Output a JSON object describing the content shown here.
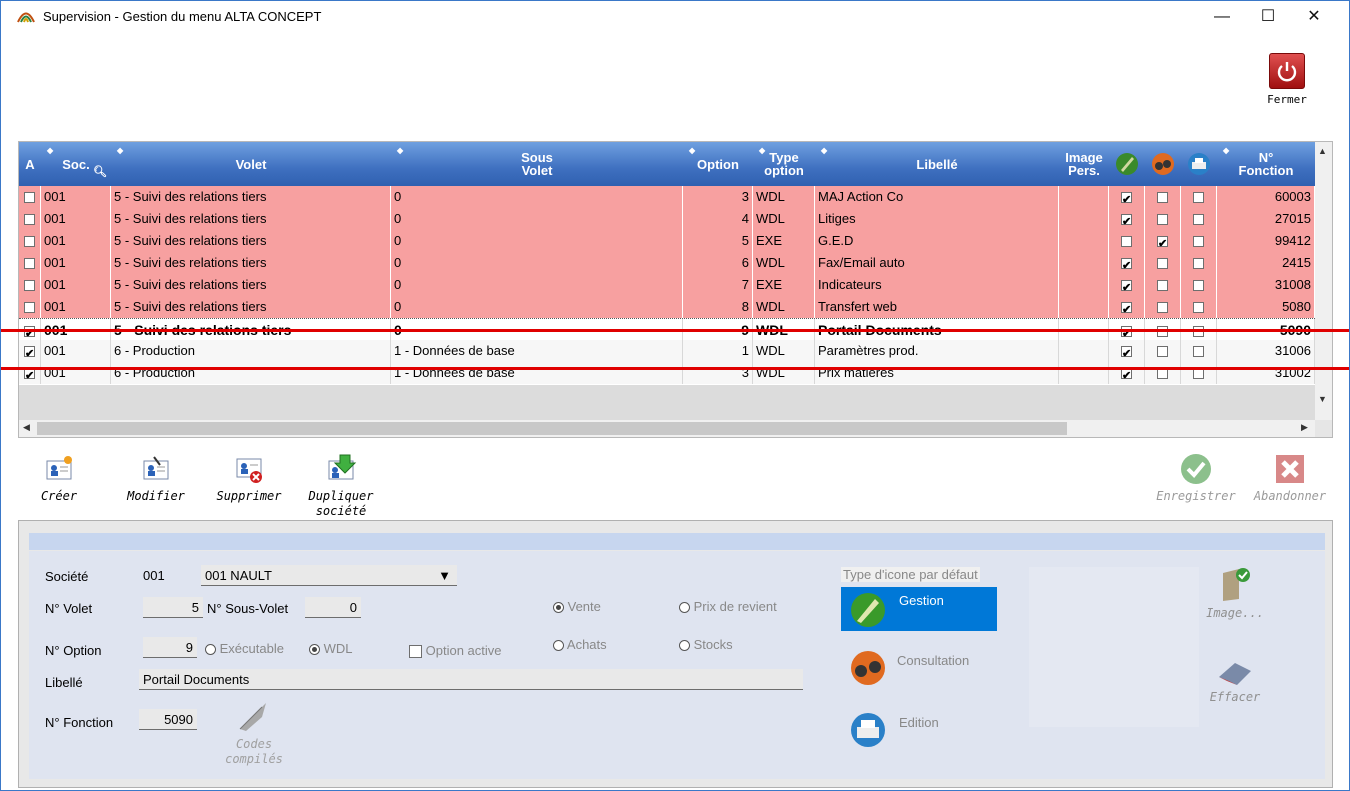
{
  "window": {
    "title": "Supervision - Gestion du menu ALTA CONCEPT",
    "minimize": "—",
    "maximize": "☐",
    "close": "✕",
    "fermer_label": "Fermer"
  },
  "grid": {
    "headers": {
      "a": "A",
      "soc": "Soc.",
      "volet": "Volet",
      "sous_volet_1": "Sous",
      "sous_volet_2": "Volet",
      "option": "Option",
      "type_1": "Type",
      "type_2": "option",
      "libelle": "Libellé",
      "image_1": "Image",
      "image_2": "Pers.",
      "fonction_1": "N°",
      "fonction_2": "Fonction"
    },
    "rows": [
      {
        "soc": "001",
        "volet": "5 - Suivi des relations tiers",
        "sous_volet": "0",
        "option": "3",
        "type": "WDL",
        "libelle": "MAJ Action Co",
        "a": false,
        "g": true,
        "c": false,
        "e": false,
        "fonction": "60003"
      },
      {
        "soc": "001",
        "volet": "5 - Suivi des relations tiers",
        "sous_volet": "0",
        "option": "4",
        "type": "WDL",
        "libelle": "Litiges",
        "a": false,
        "g": true,
        "c": false,
        "e": false,
        "fonction": "27015"
      },
      {
        "soc": "001",
        "volet": "5 - Suivi des relations tiers",
        "sous_volet": "0",
        "option": "5",
        "type": "EXE",
        "libelle": "G.E.D",
        "a": false,
        "g": false,
        "c": true,
        "e": false,
        "fonction": "99412"
      },
      {
        "soc": "001",
        "volet": "5 - Suivi des relations tiers",
        "sous_volet": "0",
        "option": "6",
        "type": "WDL",
        "libelle": "Fax/Email auto",
        "a": false,
        "g": true,
        "c": false,
        "e": false,
        "fonction": "2415"
      },
      {
        "soc": "001",
        "volet": "5 - Suivi des relations tiers",
        "sous_volet": "0",
        "option": "7",
        "type": "EXE",
        "libelle": "Indicateurs",
        "a": false,
        "g": true,
        "c": false,
        "e": false,
        "fonction": "31008"
      },
      {
        "soc": "001",
        "volet": "5 - Suivi des relations tiers",
        "sous_volet": "0",
        "option": "8",
        "type": "WDL",
        "libelle": "Transfert web",
        "a": false,
        "g": true,
        "c": false,
        "e": false,
        "fonction": "5080"
      },
      {
        "soc": "001",
        "volet": "5 - Suivi des relations tiers",
        "sous_volet": "0",
        "option": "9",
        "type": "WDL",
        "libelle": "Portail Documents",
        "a": true,
        "g": true,
        "c": false,
        "e": false,
        "fonction": "5090"
      },
      {
        "soc": "001",
        "volet": "6 - Production",
        "sous_volet": "1 - Données de base",
        "option": "1",
        "type": "WDL",
        "libelle": "Paramètres prod.",
        "a": true,
        "g": true,
        "c": false,
        "e": false,
        "fonction": "31006"
      },
      {
        "soc": "001",
        "volet": "6 - Production",
        "sous_volet": "1 - Données de base",
        "option": "3",
        "type": "WDL",
        "libelle": "Prix matières",
        "a": true,
        "g": true,
        "c": false,
        "e": false,
        "fonction": "31002"
      }
    ]
  },
  "toolbar": {
    "creer": "Créer",
    "modifier": "Modifier",
    "supprimer": "Supprimer",
    "dupliquer_1": "Dupliquer",
    "dupliquer_2": "société",
    "enregistrer": "Enregistrer",
    "abandonner": "Abandonner"
  },
  "form": {
    "societe_label": "Société",
    "societe_code": "001",
    "societe_name": "001 NAULT",
    "volet_label": "N° Volet",
    "volet_value": "5",
    "sous_volet_label": "N° Sous-Volet",
    "sous_volet_value": "0",
    "option_label": "N° Option",
    "option_value": "9",
    "executable_label": "Exécutable",
    "wdl_label": "WDL",
    "option_active_label": "Option active",
    "vente_label": "Vente",
    "prix_revient_label": "Prix de revient",
    "achats_label": "Achats",
    "stocks_label": "Stocks",
    "libelle_label": "Libellé",
    "libelle_value": "Portail Documents",
    "fonction_label": "N° Fonction",
    "fonction_value": "5090",
    "codes_1": "Codes",
    "codes_2": "compilés",
    "type_icone_label": "Type d'icone par défaut",
    "gestion_label": "Gestion",
    "consultation_label": "Consultation",
    "edition_label": "Edition",
    "image_label": "Image...",
    "effacer_label": "Effacer"
  },
  "colors": {
    "header": "#3f70c0",
    "row_pink": "#f7a0a0",
    "highlight": "#e00000"
  }
}
